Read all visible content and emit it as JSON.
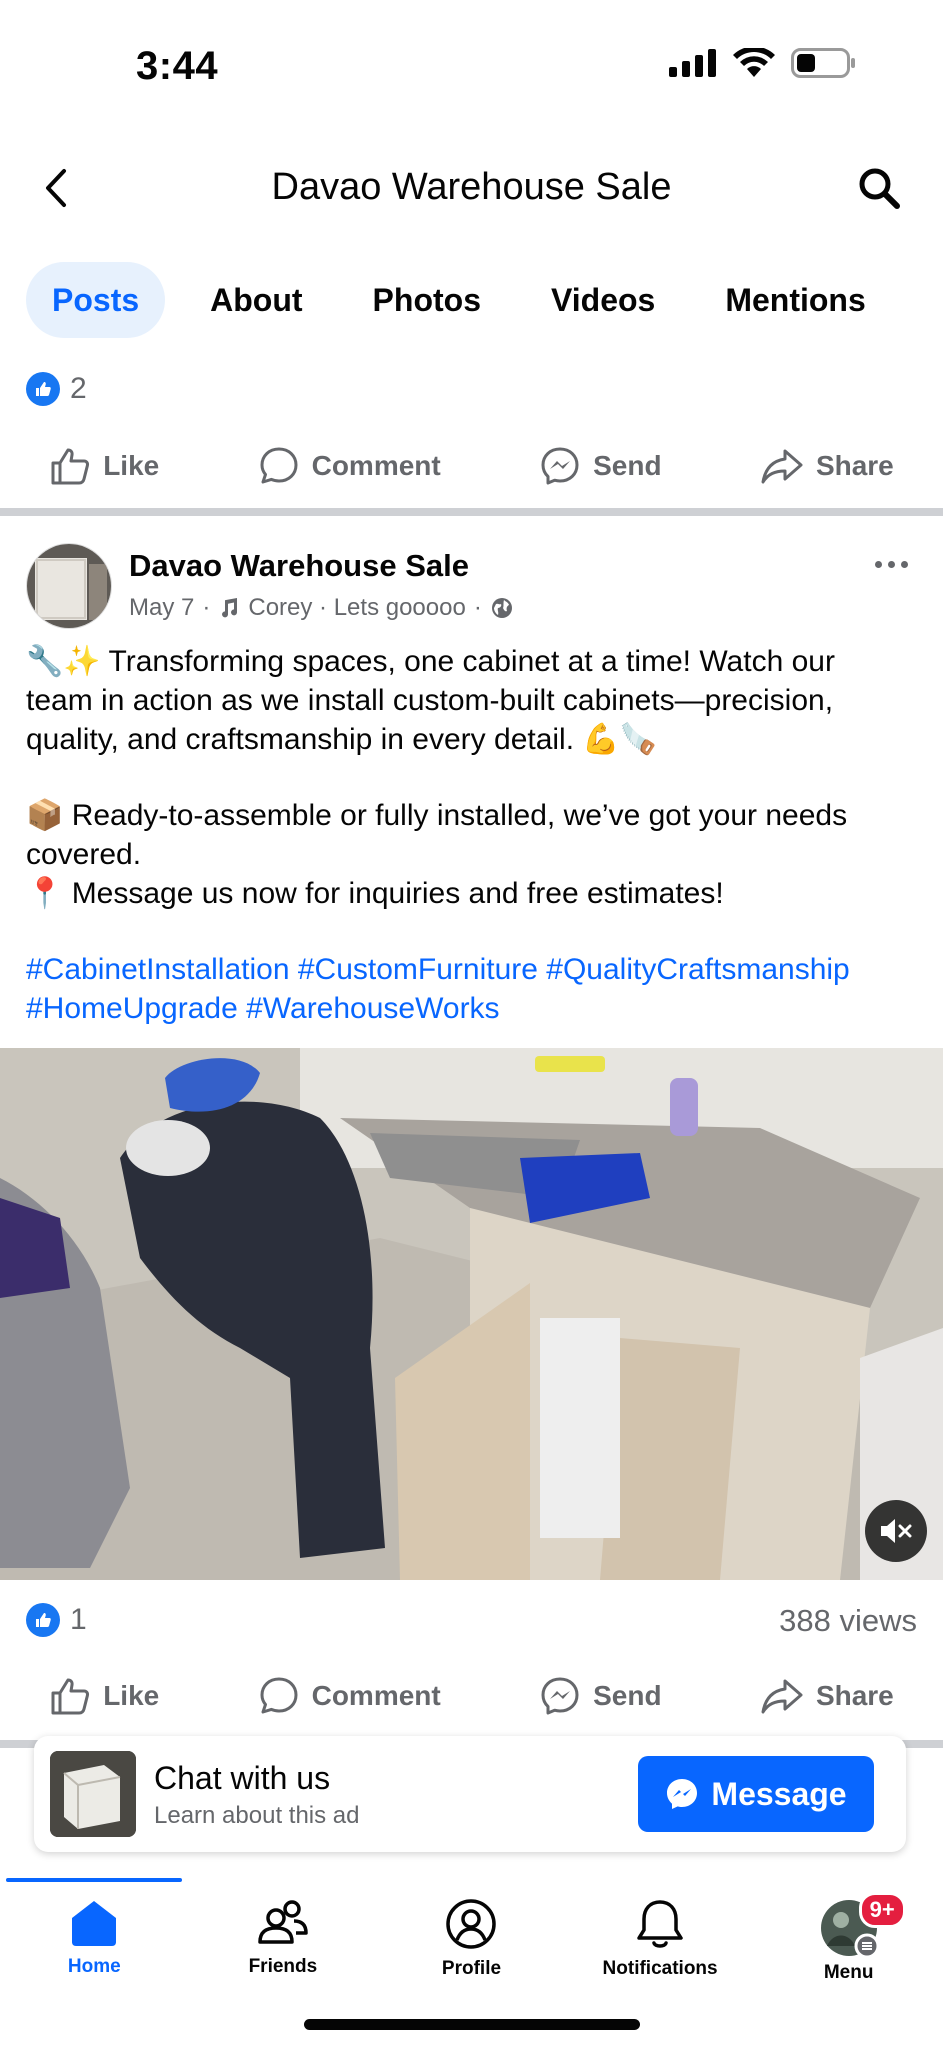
{
  "status_bar": {
    "time": "3:44"
  },
  "header": {
    "title": "Davao Warehouse Sale"
  },
  "tabs": [
    {
      "label": "Posts",
      "active": true
    },
    {
      "label": "About"
    },
    {
      "label": "Photos"
    },
    {
      "label": "Videos"
    },
    {
      "label": "Mentions"
    }
  ],
  "prev_post": {
    "reaction_count": "2",
    "actions": {
      "like": "Like",
      "comment": "Comment",
      "send": "Send",
      "share": "Share"
    }
  },
  "post": {
    "author": "Davao Warehouse Sale",
    "date": "May 7",
    "music": "Corey · Lets gooooo",
    "paragraph1": "🔧✨ Transforming spaces, one cabinet at a time! Watch our team in action as we install custom-built cabinets—precision, quality, and craftsmanship in every detail. 💪🪚",
    "paragraph2": "📦 Ready-to-assemble or fully installed, we’ve got your needs covered.",
    "paragraph3": "📍 Message us now for inquiries and free estimates!",
    "hashtags": "#CabinetInstallation #CustomFurniture #QualityCraftsmanship #HomeUpgrade #WarehouseWorks",
    "reaction_count": "1",
    "views": "388 views",
    "actions": {
      "like": "Like",
      "comment": "Comment",
      "send": "Send",
      "share": "Share"
    }
  },
  "ad": {
    "title": "Chat with us",
    "subtitle": "Learn about this ad",
    "button": "Message"
  },
  "bottom_nav": {
    "items": [
      {
        "label": "Home",
        "icon": "home-icon",
        "active": true
      },
      {
        "label": "Friends",
        "icon": "friends-icon"
      },
      {
        "label": "Profile",
        "icon": "profile-icon"
      },
      {
        "label": "Notifications",
        "icon": "bell-icon"
      },
      {
        "label": "Menu",
        "icon": "menu-avatar"
      }
    ],
    "menu_badge": "9+"
  },
  "colors": {
    "accent": "#0866ff",
    "secondary_text": "#65676b",
    "badge": "#e41e3f"
  }
}
